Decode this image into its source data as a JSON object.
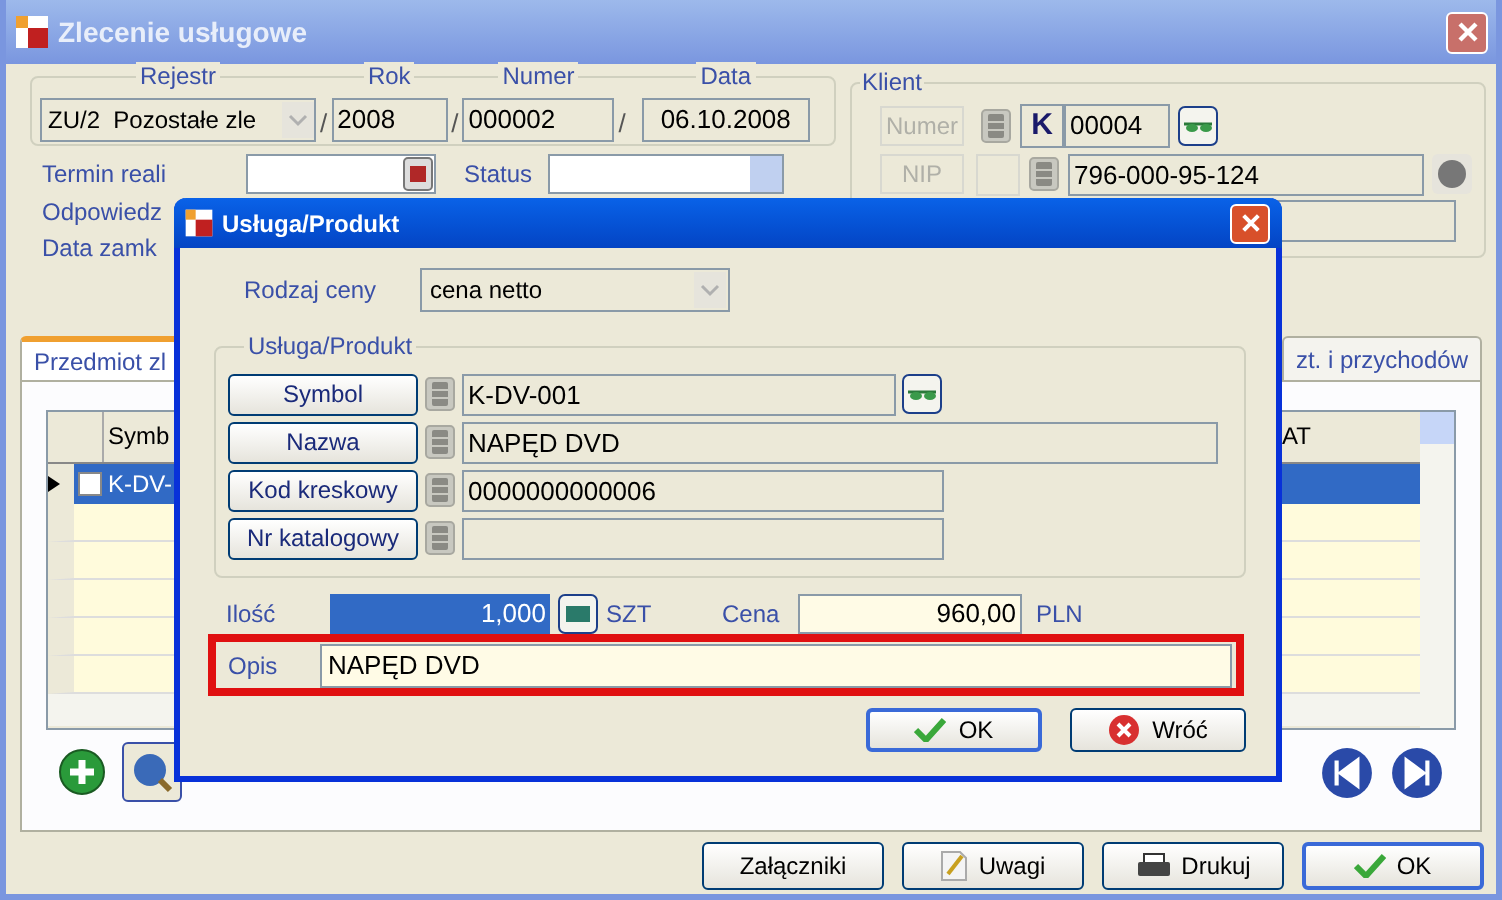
{
  "window": {
    "title": "Zlecenie usługowe",
    "active": false
  },
  "header": {
    "columns": [
      {
        "label": "Rejestr",
        "value": "ZU/2  Pozostałe zle",
        "kind": "select"
      },
      {
        "label": "Rok",
        "value": "2008",
        "kind": "field"
      },
      {
        "label": "Numer",
        "value": "000002",
        "kind": "field"
      },
      {
        "label": "Data",
        "value": "06.10.2008",
        "kind": "field"
      }
    ],
    "separator": "/"
  },
  "klient": {
    "title": "Klient",
    "numer_label": "Numer",
    "prefix": "K",
    "numer": "00004",
    "nip_label": "NIP",
    "nip": "796-000-95-124"
  },
  "form_rows": [
    {
      "label": "Termin reali"
    },
    {
      "label": "Odpowiedz"
    },
    {
      "label": "Data zamk"
    }
  ],
  "status_label": "Status",
  "tabs": [
    {
      "label": "Przedmiot zl",
      "selected": true
    },
    {
      "label": "zt. i przychodów",
      "selected": false
    }
  ],
  "grid": {
    "columns": [
      "Symb",
      "AT"
    ],
    "rows": [
      {
        "symbol": "K-DV-",
        "selected": true,
        "checked": false
      }
    ]
  },
  "footer_buttons": [
    {
      "label": "Załączniki",
      "kind": "plain"
    },
    {
      "label": "Uwagi",
      "kind": "notes"
    },
    {
      "label": "Drukuj",
      "kind": "print"
    },
    {
      "label": "OK",
      "kind": "ok"
    }
  ],
  "dialog": {
    "title": "Usługa/Produkt",
    "price_type_label": "Rodzaj ceny",
    "price_type": "cena netto",
    "group_title": "Usługa/Produkt",
    "lookups": [
      {
        "button": "Symbol",
        "value": "K-DV-001",
        "kind": "search"
      },
      {
        "button": "Nazwa",
        "value": "NAPĘD DVD",
        "kind": "wide"
      },
      {
        "button": "Kod kreskowy",
        "value": "0000000000006",
        "kind": "short"
      },
      {
        "button": "Nr katalogowy",
        "kind": "short"
      }
    ],
    "quantity_label": "Ilość",
    "quantity": "1,000",
    "unit": "SZT",
    "price_label": "Cena",
    "price": "960,00",
    "currency": "PLN",
    "description_label": "Opis",
    "description": "NAPĘD DVD",
    "description_highlighted": true,
    "buttons": [
      {
        "label": "OK",
        "kind": "ok"
      },
      {
        "label": "Wróć",
        "kind": "cancel"
      }
    ]
  }
}
